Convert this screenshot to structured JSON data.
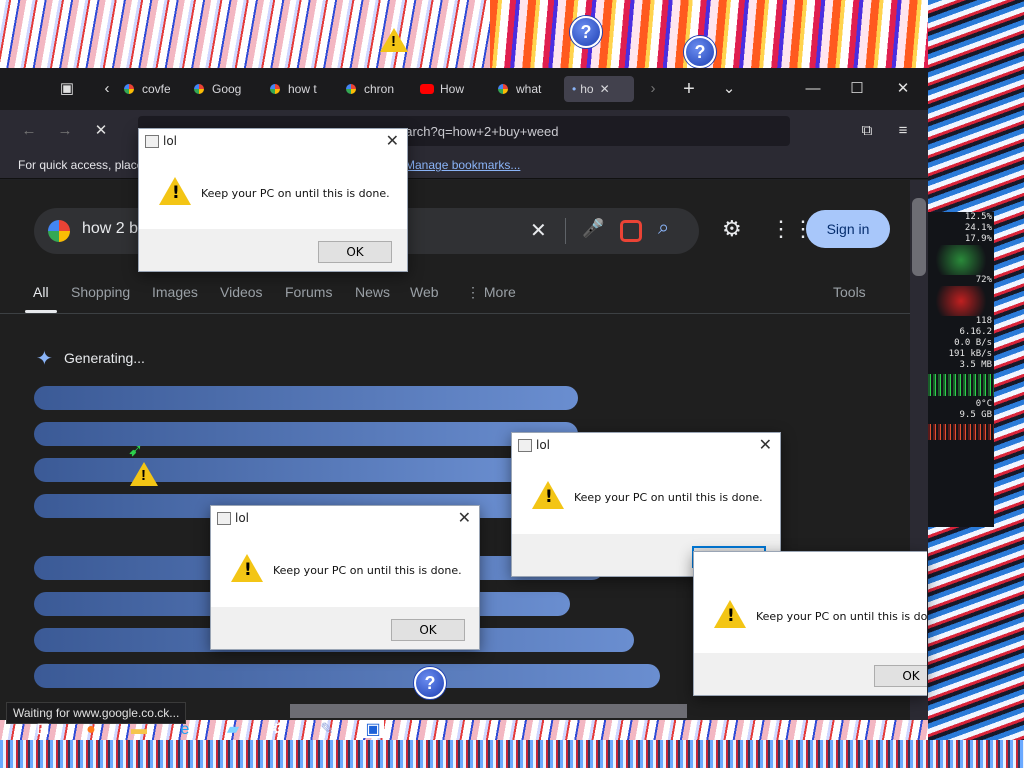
{
  "browser": {
    "tabs": [
      {
        "label": "covfe",
        "icon": "favicon-icon"
      },
      {
        "label": "Goog",
        "icon": "google-icon"
      },
      {
        "label": "how t",
        "icon": "google-icon"
      },
      {
        "label": "chron",
        "icon": "google-icon"
      },
      {
        "label": "How",
        "icon": "youtube-icon"
      },
      {
        "label": "what",
        "icon": "google-icon"
      },
      {
        "label": "ho",
        "icon": "loading-icon",
        "active": true
      }
    ],
    "url_visible": "earch?q=how+2+buy+weed",
    "bookmarks_text": "For quick access, place",
    "bookmarks_link": "Manage bookmarks...",
    "status_text": "Waiting for www.google.co.ck..."
  },
  "google": {
    "query": "how 2 b",
    "sign_in": "Sign in",
    "tabs": [
      "All",
      "Shopping",
      "Images",
      "Videos",
      "Forums",
      "News",
      "Web",
      "More"
    ],
    "tools": "Tools",
    "generating": "Generating..."
  },
  "dialogs": [
    {
      "title": "lol",
      "message": "Keep your PC on until this is done.",
      "ok": "OK"
    },
    {
      "title": "lol",
      "message": "Keep your PC on until this is done.",
      "ok": "OK"
    },
    {
      "title": "lol",
      "message": "Keep your PC on until this is done.",
      "ok": "OK"
    },
    {
      "title": "",
      "message": "Keep your PC on until this is done",
      "ok": "OK"
    }
  ],
  "sysmon": {
    "lines": [
      "12.5%",
      "24.1%",
      "17.9%",
      "72%",
      "118",
      "6.16.2",
      "0.0 B/s",
      "191 kB/s",
      "3.5 MB",
      "0°C",
      "9.5 GB"
    ]
  },
  "colors": {
    "accent": "#a8c7fa",
    "warning": "#f3c515",
    "dialog_focus": "#0078d7"
  }
}
